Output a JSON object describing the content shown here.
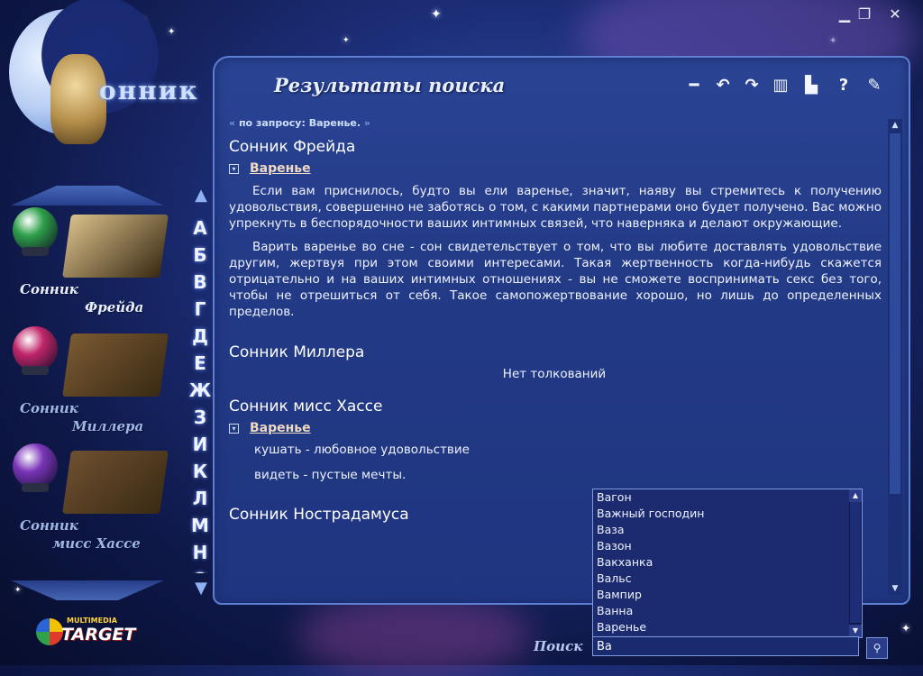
{
  "window": {
    "minimize": "▁",
    "restore": "❐",
    "close": "✕"
  },
  "logo": {
    "text": "онник"
  },
  "books": [
    {
      "line1": "Сонник",
      "line2": "Фрейда",
      "orb_color": "#2ea04a",
      "selected": true
    },
    {
      "line1": "Сонник",
      "line2": "Миллера",
      "orb_color": "#c0266a",
      "selected": false
    },
    {
      "line1": "Сонник",
      "line2": "мисс Хассе",
      "orb_color": "#7a35b8",
      "selected": false
    }
  ],
  "alphabet": [
    "А",
    "Б",
    "В",
    "Г",
    "Д",
    "Е",
    "Ж",
    "З",
    "И",
    "К",
    "Л",
    "М",
    "Н",
    "О"
  ],
  "panel": {
    "title": "Результаты поиска",
    "toolbar": [
      {
        "name": "minus-icon",
        "glyph": "━"
      },
      {
        "name": "undo-icon",
        "glyph": "↶"
      },
      {
        "name": "redo-icon",
        "glyph": "↷"
      },
      {
        "name": "book-icon",
        "glyph": "▥"
      },
      {
        "name": "print-icon",
        "glyph": "▙"
      },
      {
        "name": "help-icon",
        "glyph": "?"
      },
      {
        "name": "edit-icon",
        "glyph": "✎"
      }
    ]
  },
  "query": {
    "prefix": "по запросу: Варенье."
  },
  "results": {
    "freud": {
      "title": "Сонник Фрейда",
      "word": "Варенье",
      "p1": "Если вам приснилось, будто вы ели варенье, значит, наяву вы стремитесь к получению удовольствия, совершенно не заботясь о том, с какими партнерами оно будет получено. Вас можно упрекнуть в беспорядочности ваших интимных связей, что наверняка и делают окружающие.",
      "p2": "Варить варенье во сне - сон свидетельствует о том, что вы любите доставлять удовольствие другим, жертвуя при этом своими интересами. Такая жертвенность когда-нибудь скажется отрицательно и на ваших интимных отношениях - вы не сможете воспринимать секс без того, чтобы не отрешиться от себя. Такое самопожертвование хорошо, но лишь до определенных пределов."
    },
    "miller": {
      "title": "Сонник Миллера",
      "none": "Нет толкований"
    },
    "hasse": {
      "title": "Сонник мисс Хассе",
      "word": "Варенье",
      "l1": "кушать - любовное удовольствие",
      "l2": "видеть - пустые мечты."
    },
    "nostradamus": {
      "title": "Сонник Нострадамуса"
    }
  },
  "suggestions": [
    "Вагон",
    "Важный господин",
    "Ваза",
    "Вазон",
    "Вакханка",
    "Вальс",
    "Вампир",
    "Ванна",
    "Варенье"
  ],
  "search": {
    "label": "Поиск",
    "value": "Ва"
  },
  "brand": {
    "top": "MULTIMEDIA",
    "name": "TARGET"
  }
}
